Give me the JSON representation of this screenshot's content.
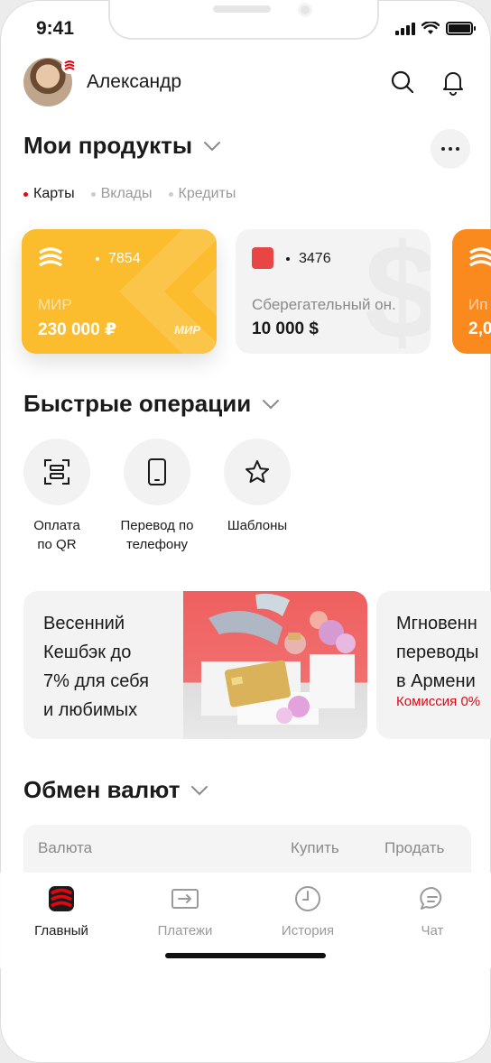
{
  "status": {
    "time": "9:41"
  },
  "header": {
    "user_name": "Александр"
  },
  "products": {
    "title": "Мои продукты",
    "filters": [
      "Карты",
      "Вклады",
      "Кредиты"
    ],
    "cards": [
      {
        "number": "7854",
        "system": "МИР",
        "amount": "230 000 ₽",
        "brand": "МИР"
      },
      {
        "number": "3476",
        "name": "Сберегательный он.",
        "amount": "10 000 $"
      },
      {
        "name": "Ип",
        "amount": "2,0"
      }
    ]
  },
  "quick_ops": {
    "title": "Быстрые операции",
    "items": [
      {
        "label": "Оплата\nпо QR",
        "icon": "qr-scan-icon"
      },
      {
        "label": "Перевод по\nтелефону",
        "icon": "phone-icon"
      },
      {
        "label": "Шаблоны",
        "icon": "star-icon"
      }
    ]
  },
  "promos": [
    {
      "text": "Весенний\nКешбэк до\n7% для себя\nи любимых"
    },
    {
      "text": "Мгновенн\nпереводы\nв Армени",
      "sub": "Комиссия 0%"
    }
  ],
  "exchange": {
    "title": "Обмен валют",
    "columns": [
      "Валюта",
      "Купить",
      "Продать"
    ]
  },
  "tabbar": {
    "items": [
      {
        "label": "Главный",
        "icon": "home-logo-icon",
        "active": true
      },
      {
        "label": "Платежи",
        "icon": "payments-icon"
      },
      {
        "label": "История",
        "icon": "history-clock-icon"
      },
      {
        "label": "Чат",
        "icon": "chat-icon"
      }
    ]
  },
  "colors": {
    "accent": "#e30611",
    "card_yellow": "#fbbc2d",
    "card_orange": "#fb8a1e"
  }
}
